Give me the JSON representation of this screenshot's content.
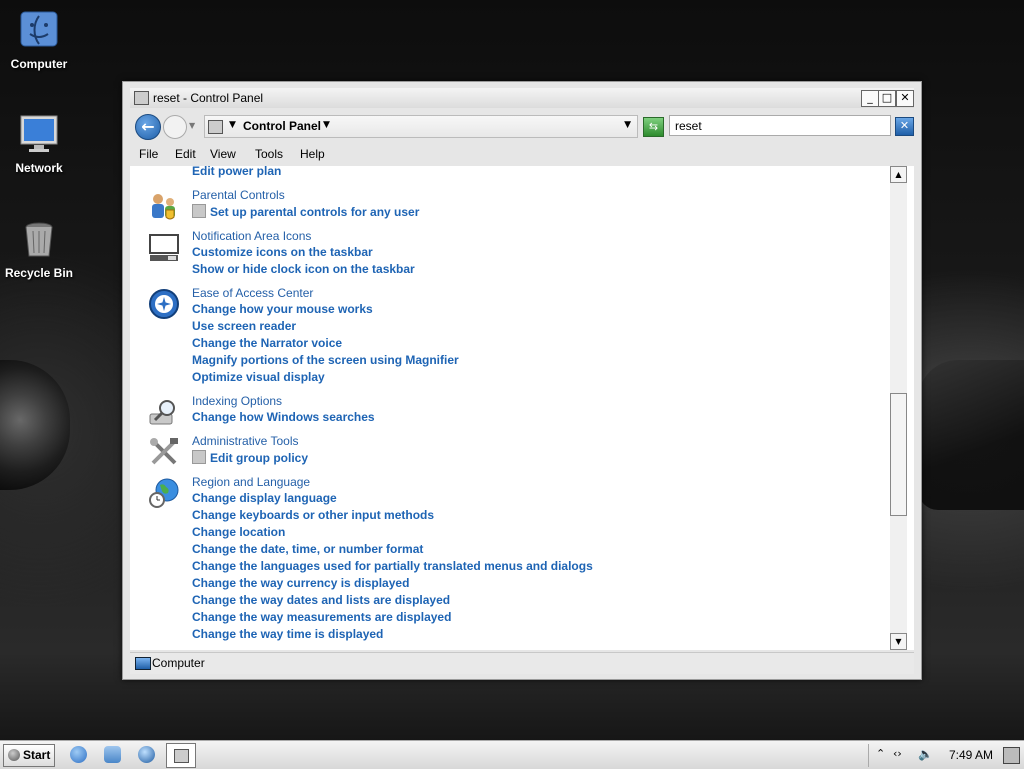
{
  "desktop": {
    "icons": [
      {
        "label": "Computer"
      },
      {
        "label": "Network"
      },
      {
        "label": "Recycle Bin"
      }
    ]
  },
  "window": {
    "title": "reset - Control Panel",
    "address": {
      "crumb": "Control Panel",
      "search_value": "reset"
    },
    "menu": [
      "File",
      "Edit",
      "View",
      "Tools",
      "Help"
    ],
    "groups": [
      {
        "title": "",
        "links": [
          "Edit power plan"
        ],
        "icon": "power-icon"
      },
      {
        "title": "Parental Controls",
        "links": [
          "Set up parental controls for any user"
        ],
        "icon": "parental-controls-icon"
      },
      {
        "title": "Notification Area Icons",
        "links": [
          "Customize icons on the taskbar",
          "Show or hide clock icon on the taskbar"
        ],
        "icon": "notification-area-icon"
      },
      {
        "title": "Ease of Access Center",
        "links": [
          "Change how your mouse works",
          "Use screen reader",
          "Change the Narrator voice",
          "Magnify portions of the screen using Magnifier",
          "Optimize visual display"
        ],
        "icon": "ease-of-access-icon"
      },
      {
        "title": "Indexing Options",
        "links": [
          "Change how Windows searches"
        ],
        "icon": "indexing-icon"
      },
      {
        "title": "Administrative Tools",
        "links": [
          "Edit group policy"
        ],
        "icon": "administrative-tools-icon"
      },
      {
        "title": "Region and Language",
        "links": [
          "Change display language",
          "Change keyboards or other input methods",
          "Change location",
          "Change the date, time, or number format",
          "Change the languages used for partially translated menus and dialogs",
          "Change the way currency is displayed",
          "Change the way dates and lists are displayed",
          "Change the way measurements are displayed",
          "Change the way time is displayed"
        ],
        "icon": "region-language-icon"
      }
    ],
    "status": "Computer"
  },
  "taskbar": {
    "start_label": "Start",
    "clock": "7:49 AM"
  },
  "colors": {
    "link": "#1e64b4",
    "group_title": "#2560a8"
  }
}
